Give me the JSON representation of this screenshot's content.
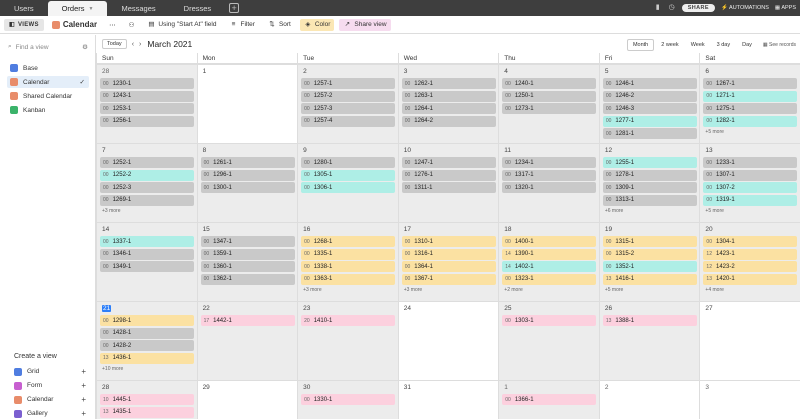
{
  "topbar": {
    "tabs": [
      {
        "label": "Users",
        "active": false
      },
      {
        "label": "Orders",
        "active": true
      },
      {
        "label": "Messages",
        "active": false
      },
      {
        "label": "Dresses",
        "active": false
      }
    ],
    "share_label": "SHARE",
    "automations_label": "AUTOMATIONS",
    "apps_label": "APPS"
  },
  "toolbar": {
    "views_label": "VIEWS",
    "view_name": "Calendar",
    "using_field_label": "Using \"Start At\" field",
    "filter_label": "Filter",
    "sort_label": "Sort",
    "color_label": "Color",
    "share_view_label": "Share view"
  },
  "sidebar": {
    "find_placeholder": "Find a view",
    "views": [
      {
        "label": "Base",
        "color": "#4f7de0",
        "selected": false
      },
      {
        "label": "Calendar",
        "color": "#e88c6a",
        "selected": true
      },
      {
        "label": "Shared Calendar",
        "color": "#e88c6a",
        "selected": false
      },
      {
        "label": "Kanban",
        "color": "#3bb36a",
        "selected": false
      }
    ],
    "create_label": "Create a view",
    "create_items": [
      {
        "label": "Grid",
        "color": "#4f7de0"
      },
      {
        "label": "Form",
        "color": "#c75fd0"
      },
      {
        "label": "Calendar",
        "color": "#e88c6a"
      },
      {
        "label": "Gallery",
        "color": "#7b5fd0"
      }
    ]
  },
  "calendar": {
    "today_label": "Today",
    "month_label": "March 2021",
    "ranges": [
      "Month",
      "2 week",
      "Week",
      "3 day",
      "Day"
    ],
    "active_range": "Month",
    "see_records_label": "See records",
    "weekdays": [
      "Sun",
      "Mon",
      "Tue",
      "Wed",
      "Thu",
      "Fri",
      "Sat"
    ],
    "weeks": [
      [
        {
          "day": "28",
          "muted": true,
          "events": [
            [
              "00",
              "1230-1",
              "gray"
            ],
            [
              "00",
              "1243-1",
              "gray"
            ],
            [
              "00",
              "1253-1",
              "gray"
            ],
            [
              "00",
              "1256-1",
              "gray"
            ]
          ],
          "more": ""
        },
        {
          "day": "1",
          "events": [],
          "more": ""
        },
        {
          "day": "2",
          "events": [
            [
              "00",
              "1257-1",
              "gray"
            ],
            [
              "00",
              "1257-2",
              "gray"
            ],
            [
              "00",
              "1257-3",
              "gray"
            ],
            [
              "00",
              "1257-4",
              "gray"
            ]
          ],
          "more": ""
        },
        {
          "day": "3",
          "events": [
            [
              "00",
              "1262-1",
              "gray"
            ],
            [
              "00",
              "1263-1",
              "gray"
            ],
            [
              "00",
              "1264-1",
              "gray"
            ],
            [
              "00",
              "1264-2",
              "gray"
            ]
          ],
          "more": ""
        },
        {
          "day": "4",
          "events": [
            [
              "00",
              "1240-1",
              "gray"
            ],
            [
              "00",
              "1250-1",
              "gray"
            ],
            [
              "00",
              "1273-1",
              "gray"
            ]
          ],
          "more": ""
        },
        {
          "day": "5",
          "events": [
            [
              "00",
              "1246-1",
              "gray"
            ],
            [
              "00",
              "1246-2",
              "gray"
            ],
            [
              "00",
              "1246-3",
              "gray"
            ],
            [
              "00",
              "1277-1",
              "teal"
            ],
            [
              "00",
              "1281-1",
              "gray"
            ]
          ],
          "more": ""
        },
        {
          "day": "6",
          "events": [
            [
              "00",
              "1267-1",
              "gray"
            ],
            [
              "00",
              "1271-1",
              "teal"
            ],
            [
              "00",
              "1275-1",
              "gray"
            ],
            [
              "00",
              "1282-1",
              "teal"
            ]
          ],
          "more": "+5 more"
        }
      ],
      [
        {
          "day": "7",
          "events": [
            [
              "00",
              "1252-1",
              "gray"
            ],
            [
              "00",
              "1252-2",
              "teal"
            ],
            [
              "00",
              "1252-3",
              "gray"
            ],
            [
              "00",
              "1269-1",
              "gray"
            ]
          ],
          "more": "+3 more"
        },
        {
          "day": "8",
          "events": [
            [
              "00",
              "1261-1",
              "gray"
            ],
            [
              "00",
              "1296-1",
              "gray"
            ],
            [
              "00",
              "1300-1",
              "gray"
            ]
          ],
          "more": ""
        },
        {
          "day": "9",
          "events": [
            [
              "00",
              "1280-1",
              "gray"
            ],
            [
              "00",
              "1305-1",
              "teal"
            ],
            [
              "00",
              "1306-1",
              "teal"
            ]
          ],
          "more": ""
        },
        {
          "day": "10",
          "events": [
            [
              "00",
              "1247-1",
              "gray"
            ],
            [
              "00",
              "1276-1",
              "gray"
            ],
            [
              "00",
              "1311-1",
              "gray"
            ]
          ],
          "more": ""
        },
        {
          "day": "11",
          "events": [
            [
              "00",
              "1234-1",
              "gray"
            ],
            [
              "00",
              "1317-1",
              "gray"
            ],
            [
              "00",
              "1320-1",
              "gray"
            ]
          ],
          "more": ""
        },
        {
          "day": "12",
          "events": [
            [
              "00",
              "1255-1",
              "teal"
            ],
            [
              "00",
              "1278-1",
              "gray"
            ],
            [
              "00",
              "1309-1",
              "gray"
            ],
            [
              "00",
              "1313-1",
              "gray"
            ]
          ],
          "more": "+6 more"
        },
        {
          "day": "13",
          "events": [
            [
              "00",
              "1233-1",
              "gray"
            ],
            [
              "00",
              "1307-1",
              "gray"
            ],
            [
              "00",
              "1307-2",
              "teal"
            ],
            [
              "00",
              "1319-1",
              "teal"
            ]
          ],
          "more": "+5 more"
        }
      ],
      [
        {
          "day": "14",
          "events": [
            [
              "00",
              "1337-1",
              "teal"
            ],
            [
              "00",
              "1346-1",
              "gray"
            ],
            [
              "00",
              "1349-1",
              "gray"
            ]
          ],
          "more": ""
        },
        {
          "day": "15",
          "events": [
            [
              "00",
              "1347-1",
              "gray"
            ],
            [
              "00",
              "1359-1",
              "gray"
            ],
            [
              "00",
              "1360-1",
              "gray"
            ],
            [
              "00",
              "1362-1",
              "gray"
            ]
          ],
          "more": ""
        },
        {
          "day": "16",
          "events": [
            [
              "00",
              "1268-1",
              "yellow"
            ],
            [
              "00",
              "1335-1",
              "yellow"
            ],
            [
              "00",
              "1338-1",
              "yellow"
            ],
            [
              "00",
              "1363-1",
              "yellow"
            ]
          ],
          "more": "+3 more"
        },
        {
          "day": "17",
          "events": [
            [
              "00",
              "1310-1",
              "yellow"
            ],
            [
              "00",
              "1316-1",
              "yellow"
            ],
            [
              "00",
              "1364-1",
              "yellow"
            ],
            [
              "00",
              "1367-1",
              "yellow"
            ]
          ],
          "more": "+3 more"
        },
        {
          "day": "18",
          "events": [
            [
              "00",
              "1400-1",
              "yellow"
            ],
            [
              "14",
              "1390-1",
              "yellow"
            ],
            [
              "14",
              "1402-1",
              "teal"
            ],
            [
              "00",
              "1323-1",
              "yellow"
            ]
          ],
          "more": "+2 more"
        },
        {
          "day": "19",
          "events": [
            [
              "00",
              "1315-1",
              "yellow"
            ],
            [
              "00",
              "1315-2",
              "yellow"
            ],
            [
              "00",
              "1352-1",
              "teal"
            ],
            [
              "13",
              "1416-1",
              "yellow"
            ]
          ],
          "more": "+5 more"
        },
        {
          "day": "20",
          "events": [
            [
              "00",
              "1304-1",
              "yellow"
            ],
            [
              "12",
              "1423-1",
              "yellow"
            ],
            [
              "12",
              "1423-2",
              "yellow"
            ],
            [
              "13",
              "1420-1",
              "yellow"
            ]
          ],
          "more": "+4 more"
        }
      ],
      [
        {
          "day": "21",
          "today": true,
          "events": [
            [
              "00",
              "1298-1",
              "yellow"
            ],
            [
              "00",
              "1428-1",
              "gray"
            ],
            [
              "00",
              "1428-2",
              "gray"
            ],
            [
              "13",
              "1436-1",
              "yellow"
            ]
          ],
          "more": "+10 more"
        },
        {
          "day": "22",
          "events": [
            [
              "17",
              "1442-1",
              "pink"
            ]
          ],
          "more": ""
        },
        {
          "day": "23",
          "events": [
            [
              "20",
              "1410-1",
              "pink"
            ]
          ],
          "more": ""
        },
        {
          "day": "24",
          "events": [],
          "more": ""
        },
        {
          "day": "25",
          "events": [
            [
              "00",
              "1303-1",
              "pink"
            ]
          ],
          "more": ""
        },
        {
          "day": "26",
          "events": [
            [
              "13",
              "1388-1",
              "pink"
            ]
          ],
          "more": ""
        },
        {
          "day": "27",
          "events": [],
          "more": ""
        }
      ],
      [
        {
          "day": "28",
          "events": [
            [
              "10",
              "1445-1",
              "pink"
            ],
            [
              "13",
              "1435-1",
              "pink"
            ]
          ],
          "more": ""
        },
        {
          "day": "29",
          "events": [],
          "more": ""
        },
        {
          "day": "30",
          "events": [
            [
              "00",
              "1330-1",
              "pink"
            ]
          ],
          "more": ""
        },
        {
          "day": "31",
          "events": [],
          "more": ""
        },
        {
          "day": "1",
          "muted": true,
          "events": [
            [
              "00",
              "1366-1",
              "pink"
            ]
          ],
          "more": ""
        },
        {
          "day": "2",
          "muted": true,
          "events": [],
          "more": ""
        },
        {
          "day": "3",
          "muted": true,
          "events": [],
          "more": ""
        }
      ]
    ]
  }
}
